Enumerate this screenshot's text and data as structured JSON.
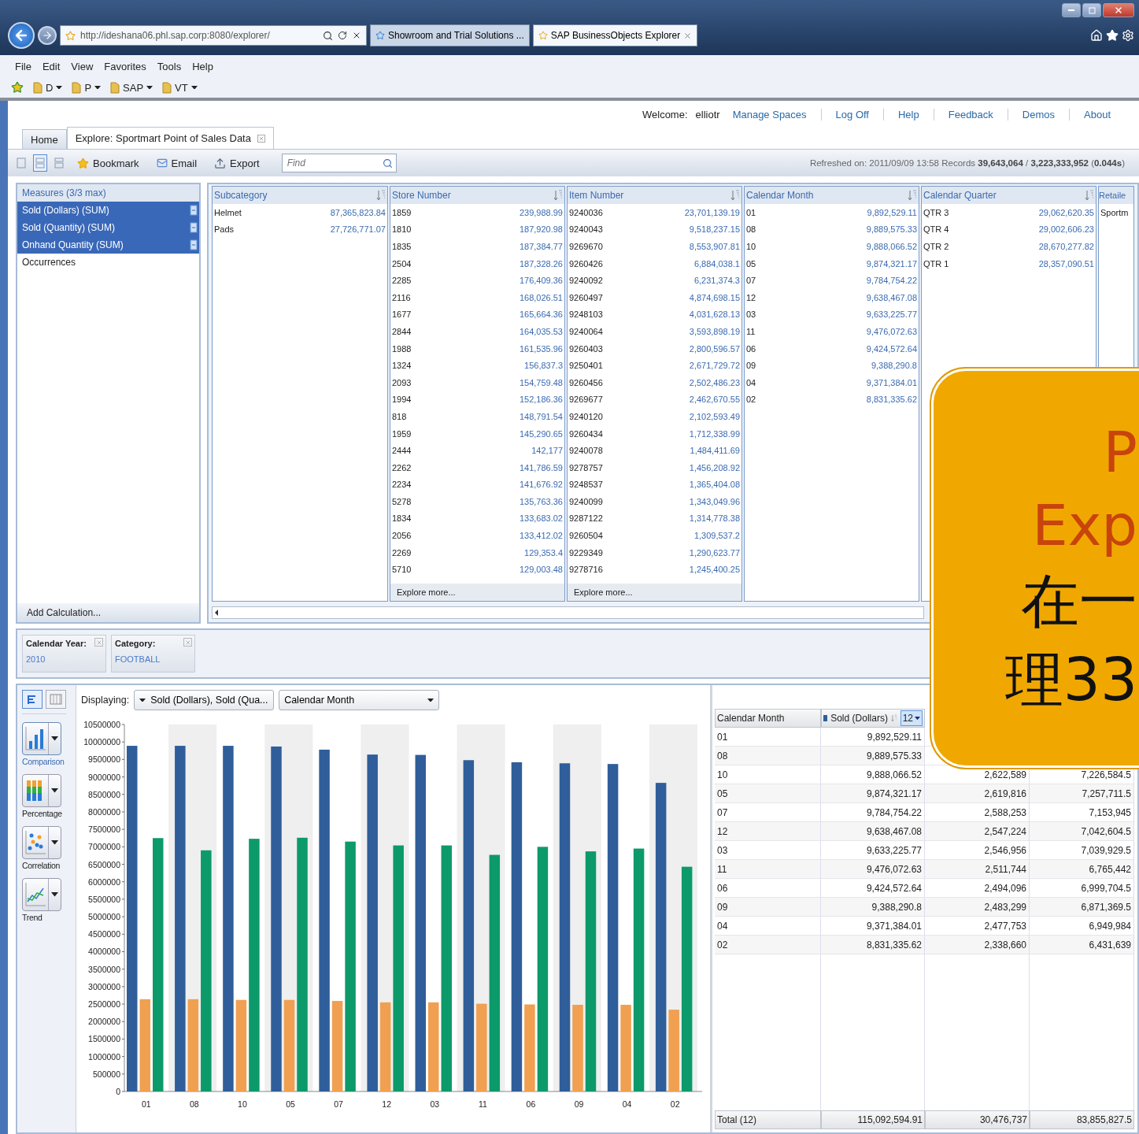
{
  "browser": {
    "address": "http://ideshana06.phl.sap.corp:8080/explorer/",
    "tabs": [
      {
        "label": "Showroom and Trial Solutions ...",
        "selected": false
      },
      {
        "label": "SAP BusinessObjects Explorer",
        "selected": true
      }
    ],
    "menu": [
      "File",
      "Edit",
      "View",
      "Favorites",
      "Tools",
      "Help"
    ],
    "favorites": [
      "D",
      "P",
      "SAP",
      "VT"
    ]
  },
  "header": {
    "welcome_label": "Welcome:",
    "user": "elliotr",
    "links": [
      "Manage Spaces",
      "Log Off",
      "Help",
      "Feedback",
      "Demos",
      "About"
    ]
  },
  "tabs": [
    {
      "label": "Home",
      "selected": false
    },
    {
      "label": "Explore: Sportmart Point of Sales Data",
      "selected": true
    }
  ],
  "toolbar": {
    "layouts": [
      {
        "kind": "single",
        "selected": false
      },
      {
        "kind": "split",
        "selected": true
      },
      {
        "kind": "bottom",
        "selected": false
      }
    ],
    "actions": [
      {
        "kind": "bookmark",
        "label": "Bookmark"
      },
      {
        "kind": "email",
        "label": "Email"
      },
      {
        "kind": "export",
        "label": "Export"
      }
    ],
    "find": {
      "placeholder": "Find"
    },
    "status": "Refreshed on: 2011/09/09 13:58 Records **39,643,064** / **3,223,333,952** (**0.044s**)"
  },
  "measures": {
    "title": "Measures (3/3 max)",
    "items": [
      {
        "label": "Sold (Dollars) (SUM)",
        "selected": true
      },
      {
        "label": "Sold (Quantity) (SUM)",
        "selected": true
      },
      {
        "label": "Onhand Quantity (SUM)",
        "selected": true
      },
      {
        "label": "Occurrences",
        "selected": false
      }
    ],
    "footer": "Add Calculation..."
  },
  "facets": [
    {
      "name": "Subcategory",
      "rows": [
        {
          "label": "Helmet",
          "value": "87,365,823.84"
        },
        {
          "label": "Pads",
          "value": "27,726,771.07"
        }
      ]
    },
    {
      "name": "Store Number",
      "explore_more": "Explore more...",
      "rows": [
        {
          "label": "1859",
          "value": "239,988.99"
        },
        {
          "label": "1810",
          "value": "187,920.98"
        },
        {
          "label": "1835",
          "value": "187,384.77"
        },
        {
          "label": "2504",
          "value": "187,328.26"
        },
        {
          "label": "2285",
          "value": "176,409.36"
        },
        {
          "label": "2116",
          "value": "168,026.51"
        },
        {
          "label": "1677",
          "value": "165,664.36"
        },
        {
          "label": "2844",
          "value": "164,035.53"
        },
        {
          "label": "1988",
          "value": "161,535.96"
        },
        {
          "label": "1324",
          "value": "156,837.3"
        },
        {
          "label": "2093",
          "value": "154,759.48"
        },
        {
          "label": "1994",
          "value": "152,186.36"
        },
        {
          "label": "818",
          "value": "148,791.54"
        },
        {
          "label": "1959",
          "value": "145,290.65"
        },
        {
          "label": "2444",
          "value": "142,177"
        },
        {
          "label": "2262",
          "value": "141,786.59"
        },
        {
          "label": "2234",
          "value": "141,676.92"
        },
        {
          "label": "5278",
          "value": "135,763.36"
        },
        {
          "label": "1834",
          "value": "133,683.02"
        },
        {
          "label": "2056",
          "value": "133,412.02"
        },
        {
          "label": "2269",
          "value": "129,353.4"
        },
        {
          "label": "5710",
          "value": "129,003.48"
        }
      ]
    },
    {
      "name": "Item Number",
      "explore_more": "Explore more...",
      "rows": [
        {
          "label": "9240036",
          "value": "23,701,139.19"
        },
        {
          "label": "9240043",
          "value": "9,518,237.15"
        },
        {
          "label": "9269670",
          "value": "8,553,907.81"
        },
        {
          "label": "9260426",
          "value": "6,884,038.1"
        },
        {
          "label": "9240092",
          "value": "6,231,374.3"
        },
        {
          "label": "9260497",
          "value": "4,874,698.15"
        },
        {
          "label": "9248103",
          "value": "4,031,628.13"
        },
        {
          "label": "9240064",
          "value": "3,593,898.19"
        },
        {
          "label": "9260403",
          "value": "2,800,596.57"
        },
        {
          "label": "9250401",
          "value": "2,671,729.72"
        },
        {
          "label": "9260456",
          "value": "2,502,486.23"
        },
        {
          "label": "9269677",
          "value": "2,462,670.55"
        },
        {
          "label": "9240120",
          "value": "2,102,593.49"
        },
        {
          "label": "9260434",
          "value": "1,712,338.99"
        },
        {
          "label": "9240078",
          "value": "1,484,411.69"
        },
        {
          "label": "9278757",
          "value": "1,456,208.92"
        },
        {
          "label": "9248537",
          "value": "1,365,404.08"
        },
        {
          "label": "9240099",
          "value": "1,343,049.96"
        },
        {
          "label": "9287122",
          "value": "1,314,778.38"
        },
        {
          "label": "9260504",
          "value": "1,309,537.2"
        },
        {
          "label": "9229349",
          "value": "1,290,623.77"
        },
        {
          "label": "9278716",
          "value": "1,245,400.25"
        }
      ]
    },
    {
      "name": "Calendar Month",
      "rows": [
        {
          "label": "01",
          "value": "9,892,529.11"
        },
        {
          "label": "08",
          "value": "9,889,575.33"
        },
        {
          "label": "10",
          "value": "9,888,066.52"
        },
        {
          "label": "05",
          "value": "9,874,321.17"
        },
        {
          "label": "07",
          "value": "9,784,754.22"
        },
        {
          "label": "12",
          "value": "9,638,467.08"
        },
        {
          "label": "03",
          "value": "9,633,225.77"
        },
        {
          "label": "11",
          "value": "9,476,072.63"
        },
        {
          "label": "06",
          "value": "9,424,572.64"
        },
        {
          "label": "09",
          "value": "9,388,290.8"
        },
        {
          "label": "04",
          "value": "9,371,384.01"
        },
        {
          "label": "02",
          "value": "8,831,335.62"
        }
      ]
    },
    {
      "name": "Calendar Quarter",
      "rows": [
        {
          "label": "QTR 3",
          "value": "29,062,620.35"
        },
        {
          "label": "QTR 4",
          "value": "29,002,606.23"
        },
        {
          "label": "QTR 2",
          "value": "28,670,277.82"
        },
        {
          "label": "QTR 1",
          "value": "28,357,090.51"
        }
      ]
    },
    {
      "name": "Retaile",
      "rows": [
        {
          "label": "Sportm"
        }
      ]
    }
  ],
  "filters": [
    {
      "name": "Calendar Year:",
      "value": "2010"
    },
    {
      "name": "Category:",
      "value": "FOOTBALL"
    }
  ],
  "view_toggle": [
    {
      "kind": "chart",
      "selected": true
    },
    {
      "kind": "table",
      "selected": false
    }
  ],
  "chart_types": [
    {
      "kind": "comparison",
      "label": "Comparison",
      "selected": true
    },
    {
      "kind": "percentage",
      "label": "Percentage",
      "selected": false
    },
    {
      "kind": "correlation",
      "label": "Correlation",
      "selected": false
    },
    {
      "kind": "trend",
      "label": "Trend",
      "selected": false
    }
  ],
  "displaying": {
    "label": "Displaying:",
    "measures": "Sold (Dollars), Sold (Qua...",
    "dimension": "Calendar Month"
  },
  "chart": {
    "chart_data": {
      "type": "bar",
      "categories": [
        "01",
        "08",
        "10",
        "05",
        "07",
        "12",
        "03",
        "11",
        "06",
        "09",
        "04",
        "02"
      ],
      "series": [
        {
          "color": "#2f5e9a",
          "values": [
            9890000,
            9890000,
            9890000,
            9870000,
            9780000,
            9640000,
            9630000,
            9480000,
            9420000,
            9390000,
            9370000,
            8830000
          ]
        },
        {
          "color": "#f0a050",
          "values": [
            2640000,
            2640000,
            2620000,
            2620000,
            2590000,
            2550000,
            2550000,
            2510000,
            2490000,
            2480000,
            2480000,
            2340000
          ]
        },
        {
          "color": "#0c9a6a",
          "values": [
            7250000,
            6900000,
            7230000,
            7260000,
            7150000,
            7040000,
            7040000,
            6770000,
            7000000,
            6870000,
            6950000,
            6430000
          ]
        }
      ],
      "ylim": [
        0,
        10500000
      ],
      "yticks": [
        0,
        500000,
        1000000,
        1500000,
        2000000,
        2500000,
        3000000,
        3500000,
        4000000,
        4500000,
        5000000,
        5500000,
        6000000,
        6500000,
        7000000,
        7500000,
        8000000,
        8500000,
        9000000,
        9500000,
        10000000,
        10500000
      ]
    }
  },
  "data_table": {
    "columns": [
      "Calendar Month",
      "Sold (Dollars)"
    ],
    "top_n": "12",
    "rows": [
      {
        "cells": [
          "01",
          "9,892,529.11"
        ]
      },
      {
        "cells": [
          "08",
          "9,889,575.33"
        ]
      },
      {
        "cells": [
          "10",
          "9,888,066.52",
          "2,622,589",
          "7,226,584.5"
        ]
      },
      {
        "cells": [
          "05",
          "9,874,321.17",
          "2,619,816",
          "7,257,711.5"
        ]
      },
      {
        "cells": [
          "07",
          "9,784,754.22",
          "2,588,253",
          "7,153,945"
        ]
      },
      {
        "cells": [
          "12",
          "9,638,467.08",
          "2,547,224",
          "7,042,604.5"
        ]
      },
      {
        "cells": [
          "03",
          "9,633,225.77",
          "2,546,956",
          "7,039,929.5"
        ]
      },
      {
        "cells": [
          "11",
          "9,476,072.63",
          "2,511,744",
          "6,765,442"
        ]
      },
      {
        "cells": [
          "06",
          "9,424,572.64",
          "2,494,096",
          "6,999,704.5"
        ]
      },
      {
        "cells": [
          "09",
          "9,388,290.8",
          "2,483,299",
          "6,871,369.5"
        ]
      },
      {
        "cells": [
          "04",
          "9,371,384.01",
          "2,477,753",
          "6,949,984"
        ]
      },
      {
        "cells": [
          "02",
          "8,831,335.62",
          "2,338,660",
          "6,431,639"
        ]
      }
    ],
    "total": [
      "Total (12)",
      "115,092,594.91",
      "30,476,737",
      "83,855,827.5"
    ]
  },
  "overlay": {
    "lines": [
      {
        "kind": "title",
        "text": "P"
      },
      {
        "kind": "title",
        "text": "Exp"
      },
      {
        "kind": "body",
        "text": "在一"
      },
      {
        "kind": "body",
        "text": "理33"
      }
    ]
  }
}
